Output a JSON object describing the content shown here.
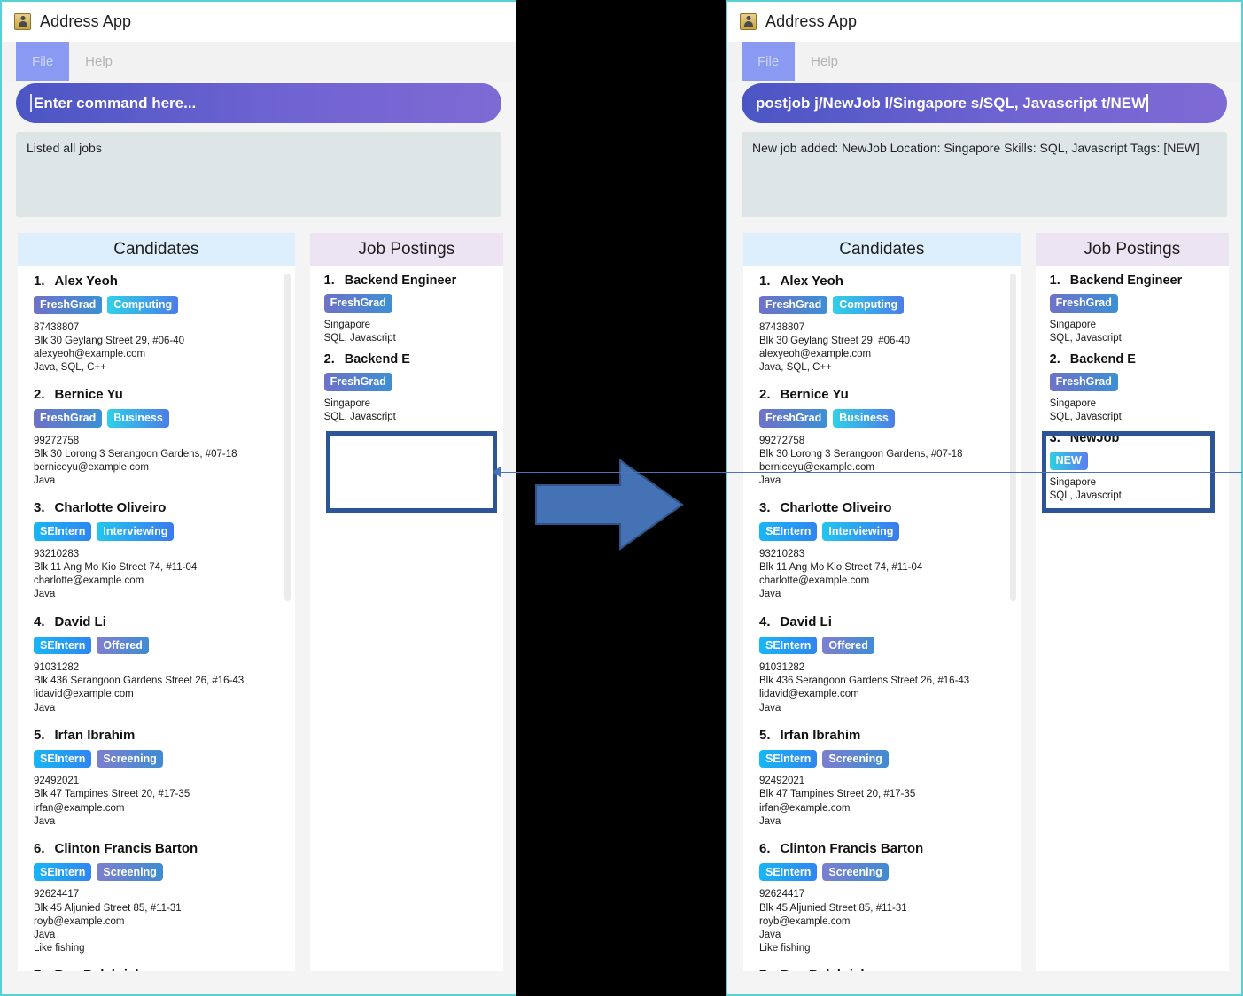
{
  "window_title": "Address App",
  "app_icon": "address-book-icon",
  "menu": {
    "file": "File",
    "help": "Help"
  },
  "before": {
    "command_value": "",
    "command_placeholder": "Enter command here...",
    "result_text": "Listed all jobs"
  },
  "after": {
    "command_value": "postjob j/NewJob l/Singapore s/SQL, Javascript t/NEW",
    "result_text": "New job added: NewJob Location: Singapore Skills: SQL, Javascript Tags: [NEW]"
  },
  "panels": {
    "candidates_header": "Candidates",
    "jobs_header": "Job Postings"
  },
  "candidates": [
    {
      "index": "1.",
      "name": "Alex Yeoh",
      "tags": [
        {
          "label": "FreshGrad",
          "style": "tag-purple"
        },
        {
          "label": "Computing",
          "style": "tag-cyan"
        }
      ],
      "phone": "87438807",
      "address": "Blk 30 Geylang Street 29, #06-40",
      "email": "alexyeoh@example.com",
      "skills": "Java, SQL, C++",
      "note": ""
    },
    {
      "index": "2.",
      "name": "Bernice Yu",
      "tags": [
        {
          "label": "FreshGrad",
          "style": "tag-purple"
        },
        {
          "label": "Business",
          "style": "tag-cyan"
        }
      ],
      "phone": "99272758",
      "address": "Blk 30 Lorong 3 Serangoon Gardens, #07-18",
      "email": "berniceyu@example.com",
      "skills": "Java",
      "note": ""
    },
    {
      "index": "3.",
      "name": "Charlotte Oliveiro",
      "tags": [
        {
          "label": "SEIntern",
          "style": "tag-blue"
        },
        {
          "label": "Interviewing",
          "style": "tag-bright"
        }
      ],
      "phone": "93210283",
      "address": "Blk 11 Ang Mo Kio Street 74, #11-04",
      "email": "charlotte@example.com",
      "skills": "Java",
      "note": ""
    },
    {
      "index": "4.",
      "name": "David Li",
      "tags": [
        {
          "label": "SEIntern",
          "style": "tag-blue"
        },
        {
          "label": "Offered",
          "style": "tag-indigo"
        }
      ],
      "phone": "91031282",
      "address": "Blk 436 Serangoon Gardens Street 26, #16-43",
      "email": "lidavid@example.com",
      "skills": "Java",
      "note": ""
    },
    {
      "index": "5.",
      "name": "Irfan Ibrahim",
      "tags": [
        {
          "label": "SEIntern",
          "style": "tag-blue"
        },
        {
          "label": "Screening",
          "style": "tag-steel"
        }
      ],
      "phone": "92492021",
      "address": "Blk 47 Tampines Street 20, #17-35",
      "email": "irfan@example.com",
      "skills": "Java",
      "note": ""
    },
    {
      "index": "6.",
      "name": "Clinton Francis Barton",
      "tags": [
        {
          "label": "SEIntern",
          "style": "tag-blue"
        },
        {
          "label": "Screening",
          "style": "tag-steel"
        }
      ],
      "phone": "92624417",
      "address": "Blk 45 Aljunied Street 85, #11-31",
      "email": "royb@example.com",
      "skills": "Java",
      "note": "Like fishing"
    },
    {
      "index": "7.",
      "name": "Roy Balakrishnan",
      "tags": [
        {
          "label": "",
          "style": "tag-blue"
        },
        {
          "label": "",
          "style": "tag-steel"
        }
      ],
      "phone": "",
      "address": "",
      "email": "",
      "skills": "",
      "note": ""
    }
  ],
  "jobs_before": [
    {
      "index": "1.",
      "title": "Backend Engineer",
      "tags": [
        {
          "label": "FreshGrad",
          "style": "tag-purple"
        }
      ],
      "location": "Singapore",
      "skills": "SQL, Javascript"
    },
    {
      "index": "2.",
      "title": "Backend E",
      "tags": [
        {
          "label": "FreshGrad",
          "style": "tag-purple"
        }
      ],
      "location": "Singapore",
      "skills": "SQL, Javascript"
    }
  ],
  "jobs_after": [
    {
      "index": "1.",
      "title": "Backend Engineer",
      "tags": [
        {
          "label": "FreshGrad",
          "style": "tag-purple"
        }
      ],
      "location": "Singapore",
      "skills": "SQL, Javascript"
    },
    {
      "index": "2.",
      "title": "Backend E",
      "tags": [
        {
          "label": "FreshGrad",
          "style": "tag-purple"
        }
      ],
      "location": "Singapore",
      "skills": "SQL, Javascript"
    },
    {
      "index": "3.",
      "title": "NewJob",
      "tags": [
        {
          "label": "NEW",
          "style": "tag-new"
        }
      ],
      "location": "Singapore",
      "skills": "SQL, Javascript"
    }
  ],
  "annotation": {
    "arrow": "right-arrow-icon",
    "arrow_color": "#4472b4",
    "highlight_color": "#2b5597",
    "connector_color": "#4a74b8"
  }
}
